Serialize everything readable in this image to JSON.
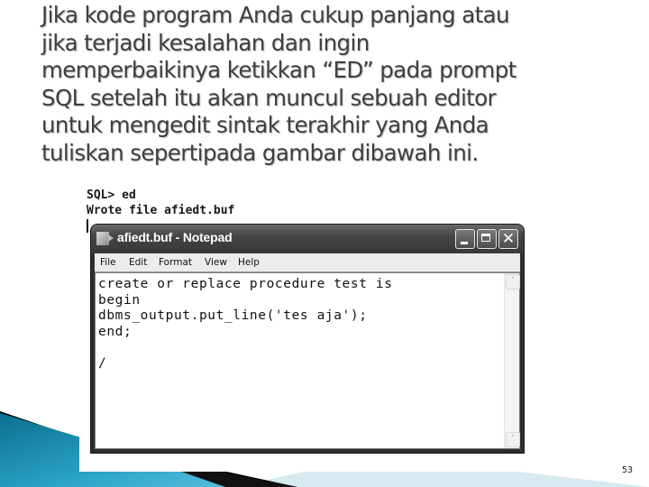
{
  "slide": {
    "paragraph_lines": [
      "Jika kode program Anda cukup panjang atau",
      "jika terjadi kesalahan dan ingin",
      "memperbaikinya ketikkan “ED” pada prompt",
      "SQL setelah itu akan muncul sebuah editor",
      "untuk mengedit sintak terakhir yang Anda",
      "tuliskan sepertipada gambar dibawah ini."
    ],
    "page_number": "53"
  },
  "console": {
    "lines": [
      "SQL> ed",
      "Wrote file afiedt.buf"
    ]
  },
  "notepad": {
    "title": "afiedt.buf - Notepad",
    "icon": "notepad-icon",
    "title_buttons": {
      "minimize": "minimize-icon",
      "maximize": "maximize-icon",
      "close": "✕"
    },
    "menu": [
      "File",
      "Edit",
      "Format",
      "View",
      "Help"
    ],
    "content_lines": [
      "create or replace procedure test is",
      "begin",
      "dbms_output.put_line('tes aja');",
      "end;",
      "",
      "/"
    ],
    "scroll_up": "˄",
    "scroll_down": "˅"
  },
  "colors": {
    "text": "#3f3f3f",
    "deco_teal": "#1a8fb0",
    "deco_light": "#d6eaf0"
  }
}
